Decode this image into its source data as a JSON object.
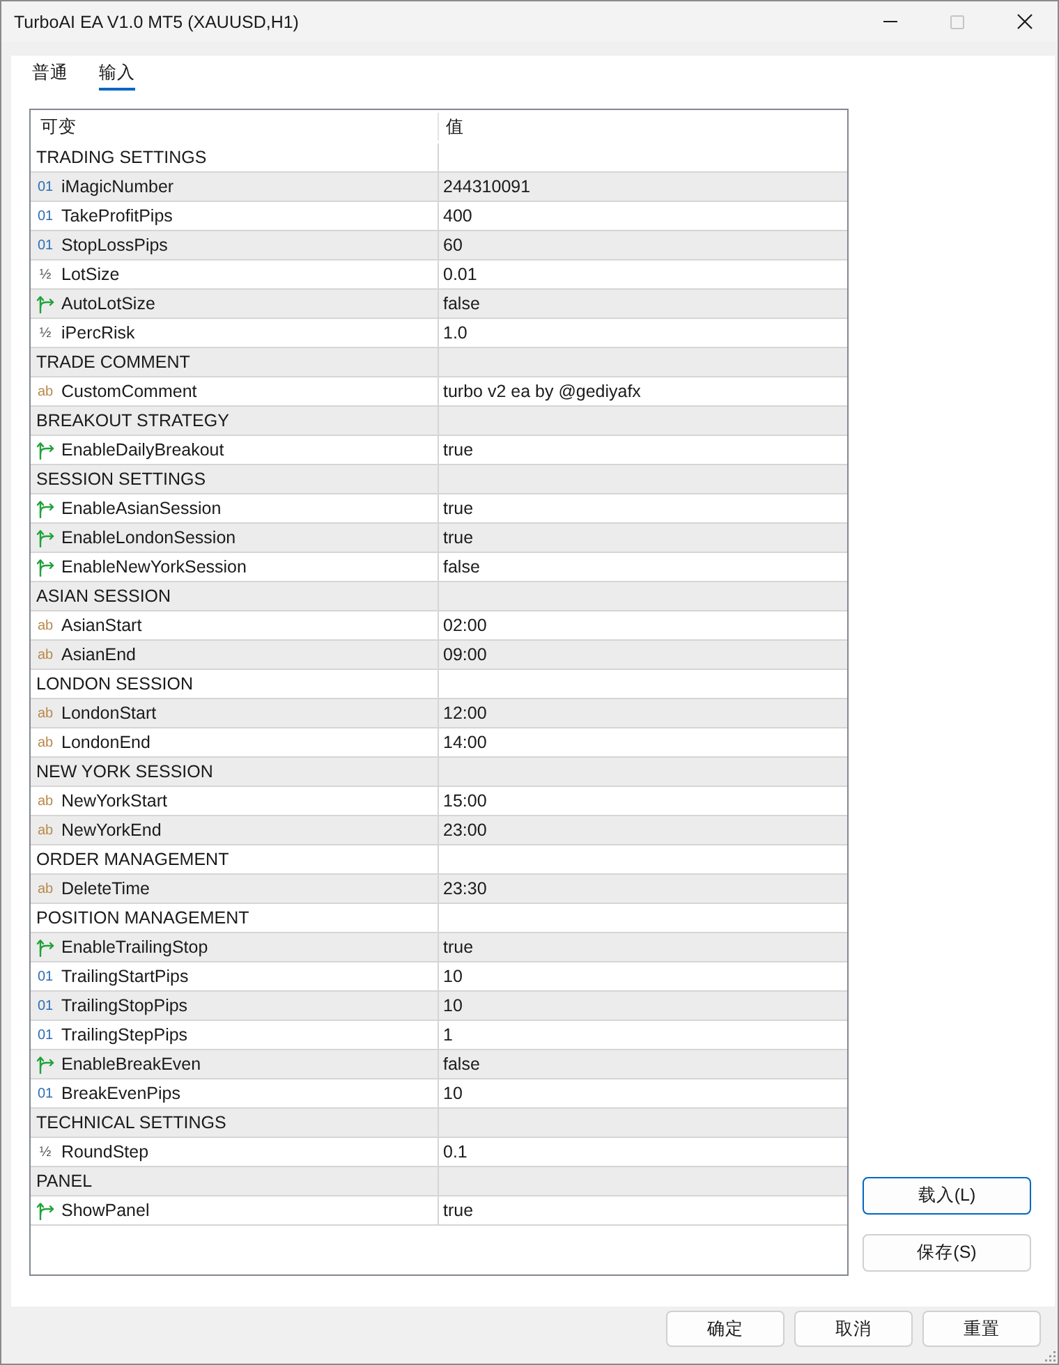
{
  "window": {
    "title": "TurboAI EA V1.0 MT5 (XAUUSD,H1)",
    "maximize_disabled": true
  },
  "tabs": [
    {
      "label": "普通",
      "selected": false
    },
    {
      "label": "输入",
      "selected": true
    }
  ],
  "table": {
    "columns": [
      "可变",
      "值"
    ],
    "rows": [
      {
        "kind": "group",
        "label": "TRADING SETTINGS"
      },
      {
        "kind": "int",
        "icon": "01",
        "name": "iMagicNumber",
        "value": "244310091"
      },
      {
        "kind": "int",
        "icon": "01",
        "name": "TakeProfitPips",
        "value": "400"
      },
      {
        "kind": "int",
        "icon": "01",
        "name": "StopLossPips",
        "value": "60"
      },
      {
        "kind": "double",
        "icon": "½",
        "name": "LotSize",
        "value": "0.01"
      },
      {
        "kind": "bool",
        "name": "AutoLotSize",
        "value": "false"
      },
      {
        "kind": "double",
        "icon": "½",
        "name": "iPercRisk",
        "value": "1.0"
      },
      {
        "kind": "group",
        "label": "TRADE COMMENT"
      },
      {
        "kind": "string",
        "icon": "ab",
        "name": "CustomComment",
        "value": "turbo v2 ea by @gediyafx"
      },
      {
        "kind": "group",
        "label": "BREAKOUT STRATEGY"
      },
      {
        "kind": "bool",
        "name": "EnableDailyBreakout",
        "value": "true"
      },
      {
        "kind": "group",
        "label": "SESSION SETTINGS"
      },
      {
        "kind": "bool",
        "name": "EnableAsianSession",
        "value": "true"
      },
      {
        "kind": "bool",
        "name": "EnableLondonSession",
        "value": "true"
      },
      {
        "kind": "bool",
        "name": "EnableNewYorkSession",
        "value": "false"
      },
      {
        "kind": "group",
        "label": "ASIAN SESSION"
      },
      {
        "kind": "string",
        "icon": "ab",
        "name": "AsianStart",
        "value": "02:00"
      },
      {
        "kind": "string",
        "icon": "ab",
        "name": "AsianEnd",
        "value": "09:00"
      },
      {
        "kind": "group",
        "label": "LONDON SESSION"
      },
      {
        "kind": "string",
        "icon": "ab",
        "name": "LondonStart",
        "value": "12:00"
      },
      {
        "kind": "string",
        "icon": "ab",
        "name": "LondonEnd",
        "value": "14:00"
      },
      {
        "kind": "group",
        "label": "NEW YORK SESSION"
      },
      {
        "kind": "string",
        "icon": "ab",
        "name": "NewYorkStart",
        "value": "15:00"
      },
      {
        "kind": "string",
        "icon": "ab",
        "name": "NewYorkEnd",
        "value": "23:00"
      },
      {
        "kind": "group",
        "label": "ORDER MANAGEMENT"
      },
      {
        "kind": "string",
        "icon": "ab",
        "name": "DeleteTime",
        "value": "23:30"
      },
      {
        "kind": "group",
        "label": "POSITION MANAGEMENT"
      },
      {
        "kind": "bool",
        "name": "EnableTrailingStop",
        "value": "true"
      },
      {
        "kind": "int",
        "icon": "01",
        "name": "TrailingStartPips",
        "value": "10"
      },
      {
        "kind": "int",
        "icon": "01",
        "name": "TrailingStopPips",
        "value": "10"
      },
      {
        "kind": "int",
        "icon": "01",
        "name": "TrailingStepPips",
        "value": "1"
      },
      {
        "kind": "bool",
        "name": "EnableBreakEven",
        "value": "false"
      },
      {
        "kind": "int",
        "icon": "01",
        "name": "BreakEvenPips",
        "value": "10"
      },
      {
        "kind": "group",
        "label": "TECHNICAL SETTINGS"
      },
      {
        "kind": "double",
        "icon": "½",
        "name": "RoundStep",
        "value": "0.1"
      },
      {
        "kind": "group",
        "label": "PANEL"
      },
      {
        "kind": "bool",
        "name": "ShowPanel",
        "value": "true"
      }
    ]
  },
  "side_buttons": [
    {
      "label": "载入(L)",
      "focused": true
    },
    {
      "label": "保存(S)",
      "focused": false
    }
  ],
  "footer_buttons": [
    {
      "label": "确定"
    },
    {
      "label": "取消"
    },
    {
      "label": "重置"
    }
  ]
}
